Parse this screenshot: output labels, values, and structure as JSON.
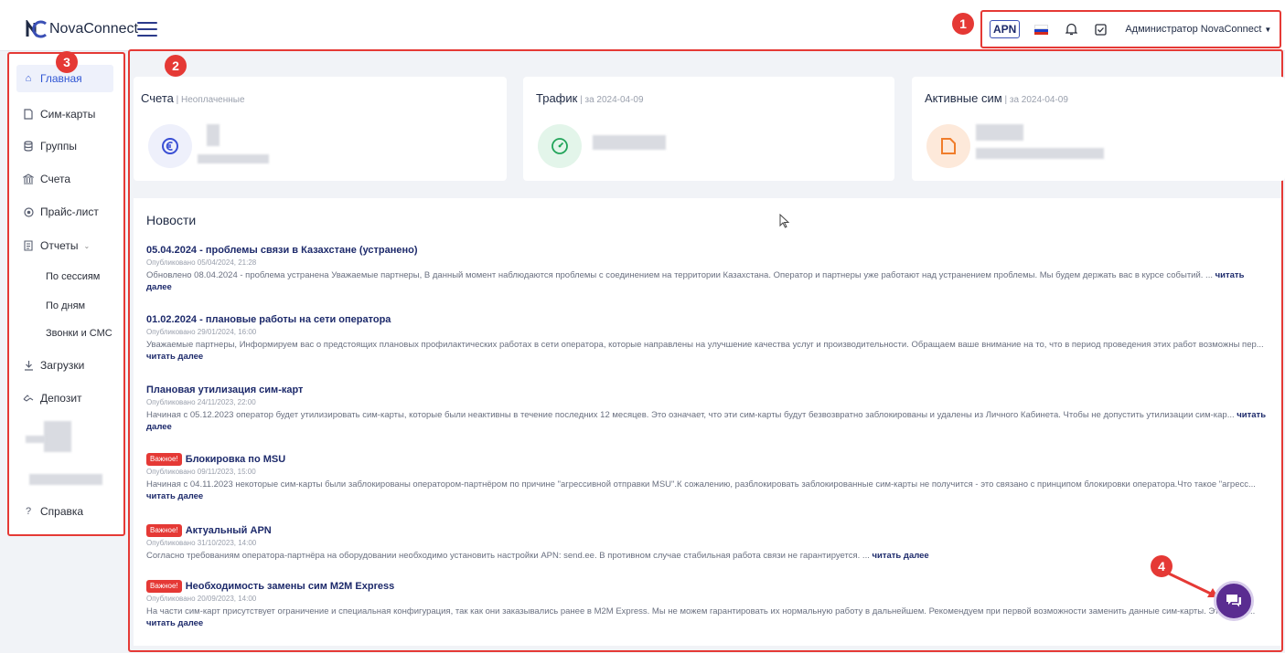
{
  "header": {
    "logo_text": "NovaConnect",
    "apn_label": "APN",
    "admin_label": "Администратор NovaConnect"
  },
  "badges": {
    "b1": "1",
    "b2": "2",
    "b3": "3",
    "b4": "4"
  },
  "sidebar": {
    "items": [
      {
        "label": "Главная",
        "icon": "home-icon"
      },
      {
        "label": "Сим-карты",
        "icon": "sim-icon"
      },
      {
        "label": "Группы",
        "icon": "database-icon"
      },
      {
        "label": "Счета",
        "icon": "bank-icon"
      },
      {
        "label": "Прайс-лист",
        "icon": "coin-icon"
      },
      {
        "label": "Отчеты",
        "icon": "report-icon"
      },
      {
        "label": "Загрузки",
        "icon": "download-icon"
      },
      {
        "label": "Депозит",
        "icon": "deposit-icon"
      },
      {
        "label": "Справка",
        "icon": "help-icon"
      }
    ],
    "sub_items": [
      "По сессиям",
      "По дням",
      "Звонки и СМС"
    ]
  },
  "cards": [
    {
      "title": "Счета",
      "sub": " | Неоплаченные"
    },
    {
      "title": "Трафик",
      "sub": " | за 2024-04-09"
    },
    {
      "title": "Активные сим",
      "sub": " | за 2024-04-09"
    }
  ],
  "news": {
    "heading": "Новости",
    "read_more": "читать далее",
    "important_tag": "Важное!",
    "items": [
      {
        "title": "05.04.2024 - проблемы связи в Казахстане (устранено)",
        "date": "Опубликовано 05/04/2024, 21:28",
        "text": "Обновлено 08.04.2024 - проблема устранена Уважаемые партнеры, В данный момент наблюдаются проблемы с соединением на территории Казахстана. Оператор и партнеры уже работают над устранением проблемы. Мы будем держать вас в курсе событий. ... "
      },
      {
        "title": "01.02.2024 - плановые работы на сети оператора",
        "date": "Опубликовано 29/01/2024, 16:00",
        "text": "Уважаемые партнеры, Информируем вас о предстоящих плановых профилактических работах в сети оператора, которые направлены на улучшение качества услуг и производительности. Обращаем ваше внимание на то, что в период проведения этих работ возможны пер... "
      },
      {
        "title": "Плановая утилизация сим-карт",
        "date": "Опубликовано 24/11/2023, 22:00",
        "text": "Начиная с 05.12.2023 оператор будет утилизировать сим-карты, которые были неактивны в течение последних 12 месяцев. Это означает, что эти сим-карты будут безвозвратно заблокированы и удалены из Личного Кабинета. Чтобы не допустить утилизации сим-кар... "
      },
      {
        "title": "Блокировка по MSU",
        "date": "Опубликовано 09/11/2023, 15:00",
        "text": "Начиная с 04.11.2023 некоторые сим-карты были заблокированы оператором-партнёром по причине \"агрессивной отправки MSU\".К сожалению, разблокировать заблокированные сим-карты не получится - это связано с принципом блокировки оператора.Что такое \"агресс... "
      },
      {
        "title": "Актуальный APN",
        "date": "Опубликовано 31/10/2023, 14:00",
        "text": "Согласно требованиям оператора-партнёра на оборудовании необходимо установить настройки APN: send.ee. В противном случае стабильная работа связи не гарантируется. ... "
      },
      {
        "title": "Необходимость замены сим M2M Express",
        "date": "Опубликовано 20/09/2023, 14:00",
        "text": "На части сим-карт присутствует ограничение и специальная конфигурация, так как они заказывались ранее в M2M Express. Мы не можем гарантировать их нормальную работу в дальнейшем. Рекомендуем при первой возможности заменить данные сим-карты. Эти сим-к... "
      }
    ]
  },
  "colors": {
    "accent": "#2f55d4",
    "highlight": "#e53935",
    "chat": "#5a2d91"
  }
}
